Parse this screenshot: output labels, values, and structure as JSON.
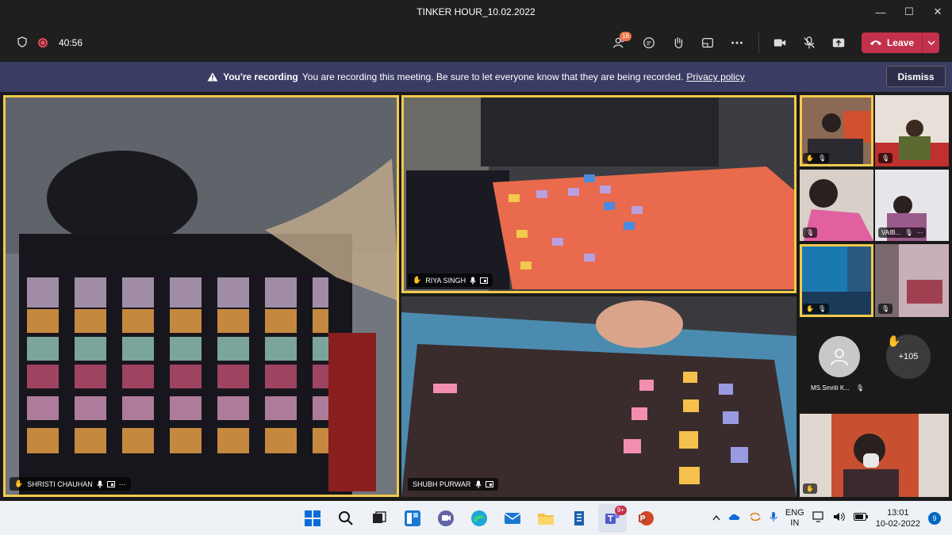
{
  "window": {
    "title": "TINKER HOUR_10.02.2022",
    "minimize": "—",
    "maximize": "☐",
    "close": "✕"
  },
  "toolbar": {
    "timer": "40:56",
    "participants_badge": "16",
    "leave_label": "Leave"
  },
  "banner": {
    "title": "You're recording",
    "message": "You are recording this meeting. Be sure to let everyone know that they are being recorded.",
    "link": "Privacy policy",
    "dismiss": "Dismiss"
  },
  "participants": {
    "main": [
      {
        "name": "SHRISTI CHAUHAN",
        "hand_raised": true,
        "more": "···"
      },
      {
        "name": "RIYA SINGH",
        "hand_raised": true
      },
      {
        "name": "SHUBH PURWAR",
        "hand_raised": false
      }
    ],
    "side": [
      {
        "name": "",
        "hand_raised": true
      },
      {
        "name": "",
        "hand_raised": false
      },
      {
        "name": "",
        "hand_raised": false
      },
      {
        "name": "VAIB...",
        "hand_raised": false,
        "more": "···"
      },
      {
        "name": "",
        "hand_raised": true
      },
      {
        "name": "",
        "hand_raised": false
      }
    ],
    "avatar_name": "MS.Smriti K...",
    "overflow_count": "+105"
  },
  "taskbar": {
    "lang_top": "ENG",
    "lang_bottom": "IN",
    "time": "13:01",
    "date": "10-02-2022",
    "notifications": "9",
    "teams_badge": "9+"
  },
  "colors": {
    "accent": "#f2c94c",
    "leave": "#c4314b",
    "banner": "#3a3c64"
  }
}
